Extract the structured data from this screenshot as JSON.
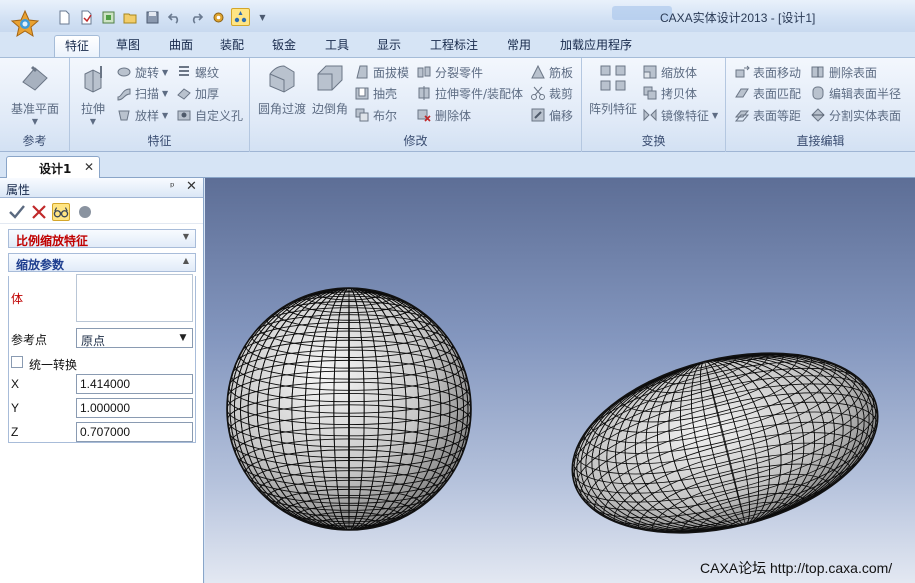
{
  "title": "CAXA实体设计2013 - [设计1]",
  "ribbon_tabs": [
    "特征",
    "草图",
    "曲面",
    "装配",
    "钣金",
    "工具",
    "显示",
    "工程标注",
    "常用",
    "加载应用程序"
  ],
  "active_tab": "特征",
  "groups": {
    "reference": {
      "label": "参考",
      "plane": "基准平面"
    },
    "feature": {
      "label": "特征",
      "extrude": "拉伸",
      "revolve": "旋转",
      "sweep": "扫描",
      "loft": "放样",
      "helix": "螺纹",
      "thicken": "加厚",
      "custom_hole": "自定义孔"
    },
    "modify": {
      "label": "修改",
      "fillet": "圆角过渡",
      "chamfer": "边倒角",
      "draft": "面拔模",
      "shell": "抽壳",
      "boolean": "布尔",
      "split_part": "分裂零件",
      "extrude_part": "拉伸零件/装配体",
      "delete_body": "删除体",
      "rib": "筋板",
      "trim": "裁剪",
      "offset": "偏移"
    },
    "transform": {
      "label": "变换",
      "array": "阵列特征",
      "scale": "缩放体",
      "copy": "拷贝体",
      "mirror": "镜像特征"
    },
    "direct_edit": {
      "label": "直接编辑",
      "move_face": "表面移动",
      "match_face": "表面匹配",
      "offset_face": "表面等距",
      "delete_face": "删除表面",
      "edit_radius": "编辑表面半径",
      "split_solid": "分割实体表面"
    }
  },
  "document_tab": "设计1",
  "panel": {
    "title": "属性",
    "feature_name": "比例缩放特征",
    "section": "缩放参数",
    "body_label": "体",
    "ref_label": "参考点",
    "ref_value": "原点",
    "uniform_label": "统一转换",
    "x_label": "X",
    "x_value": "1.414000",
    "y_label": "Y",
    "y_value": "1.000000",
    "z_label": "Z",
    "z_value": "0.707000"
  },
  "watermark": "CAXA论坛 http://top.caxa.com/",
  "colors": {
    "feature_title": "#c00000",
    "section_title": "#1f3f8f",
    "body_label": "#c00000",
    "viewport_top": "#5d6e96",
    "viewport_bottom": "#e3e8f2"
  }
}
